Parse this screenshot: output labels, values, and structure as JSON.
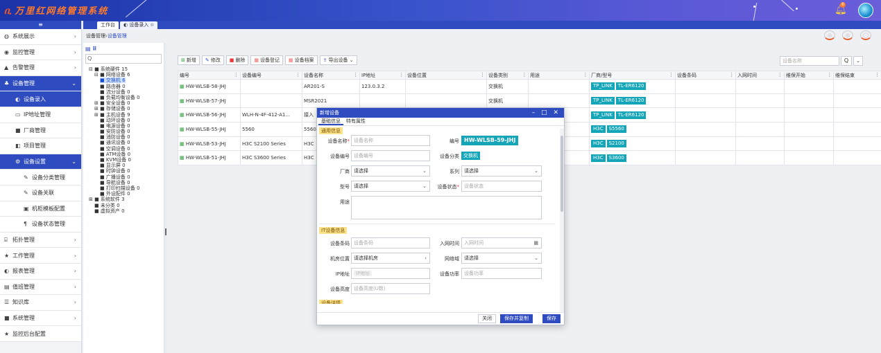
{
  "header": {
    "logo": "万里红网络管理系统",
    "notify_count": "6"
  },
  "sidebar": {
    "collapse": "≡",
    "items": [
      {
        "label": "系统展示",
        "icon": "◍"
      },
      {
        "label": "监控管理",
        "icon": "◉"
      },
      {
        "label": "告警管理",
        "icon": "▲"
      },
      {
        "label": "设备管理",
        "icon": "♣"
      },
      {
        "label": "设备录入",
        "icon": "◐"
      },
      {
        "label": "IP地址管理",
        "icon": "▭"
      },
      {
        "label": "厂商管理",
        "icon": "■"
      },
      {
        "label": "项目管理",
        "icon": "◧"
      },
      {
        "label": "设备设置",
        "icon": "⚙"
      },
      {
        "label": "设备分类管理",
        "icon": "✎"
      },
      {
        "label": "设备关联",
        "icon": "✎"
      },
      {
        "label": "机柜模板配置",
        "icon": "▣"
      },
      {
        "label": "设备状态管理",
        "icon": "¶"
      },
      {
        "label": "拓扑管理",
        "icon": "⌸"
      },
      {
        "label": "工作管理",
        "icon": "★"
      },
      {
        "label": "报表管理",
        "icon": "◐"
      },
      {
        "label": "值班管理",
        "icon": "▤"
      },
      {
        "label": "知识库",
        "icon": "☰"
      },
      {
        "label": "系统管理",
        "icon": "■"
      },
      {
        "label": "监控后台配置",
        "icon": "★"
      }
    ]
  },
  "tabs": [
    {
      "label": "工作台"
    },
    {
      "label": "◐ 设备录入",
      "close": "⊗"
    }
  ],
  "breadcrumb": {
    "root": "设备管理",
    "sep": " › ",
    "current": "设备管理"
  },
  "tree": {
    "head_icon": "▤",
    "search_icon": "Q",
    "nodes": [
      {
        "indent": 0,
        "text": "⊟ ■ 系统硬件 15"
      },
      {
        "indent": 1,
        "text": "⊟ ■ 网络设备 6"
      },
      {
        "indent": 2,
        "text": "■ 交换机 6",
        "selected": true
      },
      {
        "indent": 2,
        "text": "■ 路由器 0"
      },
      {
        "indent": 2,
        "text": "■ 流分设备 0"
      },
      {
        "indent": 2,
        "text": "■ 负载均衡设备 0"
      },
      {
        "indent": 1,
        "text": "⊞ ■ 安全设备 0"
      },
      {
        "indent": 1,
        "text": "⊞ ■ 存储设备 0"
      },
      {
        "indent": 1,
        "text": "⊞ ■ 主机设备 9"
      },
      {
        "indent": 2,
        "text": "■ 动环设备 0"
      },
      {
        "indent": 2,
        "text": "■ 电源设备 0"
      },
      {
        "indent": 2,
        "text": "■ 安防设备 0"
      },
      {
        "indent": 2,
        "text": "■ 消防设备 0"
      },
      {
        "indent": 2,
        "text": "■ 通讯设备 0"
      },
      {
        "indent": 2,
        "text": "■ 空调设备 0"
      },
      {
        "indent": 2,
        "text": "■ ATM设备 0"
      },
      {
        "indent": 2,
        "text": "■ KVM设备 0"
      },
      {
        "indent": 2,
        "text": "■ 显示屏 0"
      },
      {
        "indent": 2,
        "text": "■ 时钟设备 0"
      },
      {
        "indent": 2,
        "text": "■ 广播设备 0"
      },
      {
        "indent": 2,
        "text": "■ 导航设备 0"
      },
      {
        "indent": 2,
        "text": "■ 打印扫描设备 0"
      },
      {
        "indent": 2,
        "text": "■ 外设配件 0"
      },
      {
        "indent": 0,
        "text": "⊞ ■ 系统软件 3"
      },
      {
        "indent": 1,
        "text": "■ 未分类 0"
      },
      {
        "indent": 1,
        "text": "■ 虚拟资产 0"
      }
    ]
  },
  "toolbar": [
    {
      "icon": "⊞",
      "label": "新增"
    },
    {
      "icon": "✎",
      "label": "修改"
    },
    {
      "icon": "■",
      "label": "删除"
    },
    {
      "icon": "▦",
      "label": "设备登记"
    },
    {
      "icon": "▦",
      "label": "设备档案"
    },
    {
      "icon": "⇪",
      "label": "导出设备 ⌄"
    }
  ],
  "search": {
    "placeholder": "设备名称",
    "btn": "Q",
    "more": "⌄"
  },
  "table": {
    "headers": [
      "编号",
      "设备编号",
      "设备名称",
      "IP地址",
      "设备位置",
      "设备类别",
      "用途",
      "厂商/型号",
      "设备条码",
      "入网时间",
      "维保开始",
      "维保结束"
    ],
    "rows": [
      {
        "id": "HW-WLSB-58-JHJ",
        "code": "",
        "name": "AR201-S",
        "ip": "123.0.3.2",
        "loc": "",
        "type": "交换机",
        "use": "",
        "vendor": "TP_LINK",
        "model": "TL-ER6120"
      },
      {
        "id": "HW-WLSB-57-JHJ",
        "code": "",
        "name": "MSR2021",
        "ip": "",
        "loc": "",
        "type": "交换机",
        "use": "",
        "vendor": "TP_LINK",
        "model": "TL-ER6120"
      },
      {
        "id": "HW-WLSB-56-JHJ",
        "code": "WLH-N-4F-412-A1...",
        "name": "接入",
        "ip": "",
        "loc": "",
        "type": "",
        "use": "",
        "vendor": "TP_LINK",
        "model": "TL-ER6120"
      },
      {
        "id": "HW-WLSB-55-JHJ",
        "code": "5560",
        "name": "5560",
        "ip": "",
        "loc": "",
        "type": "",
        "use": "",
        "vendor": "H3C",
        "model": "S5560"
      },
      {
        "id": "HW-WLSB-53-JHJ",
        "code": "H3C S2100 Series",
        "name": "H3C",
        "ip": "",
        "loc": "",
        "type": "",
        "use": "",
        "vendor": "H3C",
        "model": "S2100"
      },
      {
        "id": "HW-WLSB-51-JHJ",
        "code": "H3C S3600 Series",
        "name": "H3C",
        "ip": "",
        "loc": "",
        "type": "",
        "use": "",
        "vendor": "H3C",
        "model": "S3600"
      }
    ]
  },
  "dialog": {
    "title": "新增设备",
    "controls": "– □ ✕",
    "tabs": [
      "基础信息",
      "特有属性"
    ],
    "sec_general": "通用信息",
    "sec_it": "IT设备信息",
    "sec_other": "设备详情",
    "fields": {
      "name_label": "设备名称",
      "name_ph": "设备名称",
      "code_label": "编号",
      "code_value": "HW-WLSB-59-JHJ",
      "devcode_label": "设备编号",
      "devcode_ph": "设备编号",
      "category_label": "设备分类",
      "category_value": "交换机",
      "vendor_label": "厂商",
      "vendor_value": "请选择",
      "series_label": "系列",
      "series_value": "请选择",
      "model_label": "型号",
      "model_value": "请选择",
      "status_label": "设备状态",
      "status_ph": "设备状态",
      "use_label": "用途",
      "barcode_label": "设备条码",
      "barcode_ph": "设备条码",
      "nettime_label": "入网时间",
      "nettime_ph": "入网时间",
      "room_label": "机房位置",
      "room_value": "请选择机房",
      "domain_label": "网络域",
      "domain_value": "请选择",
      "ip_label": "IP地址",
      "ip_ph": "IP地址",
      "power_label": "设备功率",
      "power_ph": "设备功率",
      "height_label": "设备高度",
      "height_ph": "设备高度(U数)"
    },
    "buttons": {
      "close": "关闭",
      "save_copy": "保存并复制",
      "save": "保存"
    }
  },
  "colors": {
    "primary": "#2e4bc0",
    "tag": "#14a6b8",
    "section": "#fbe38b"
  }
}
